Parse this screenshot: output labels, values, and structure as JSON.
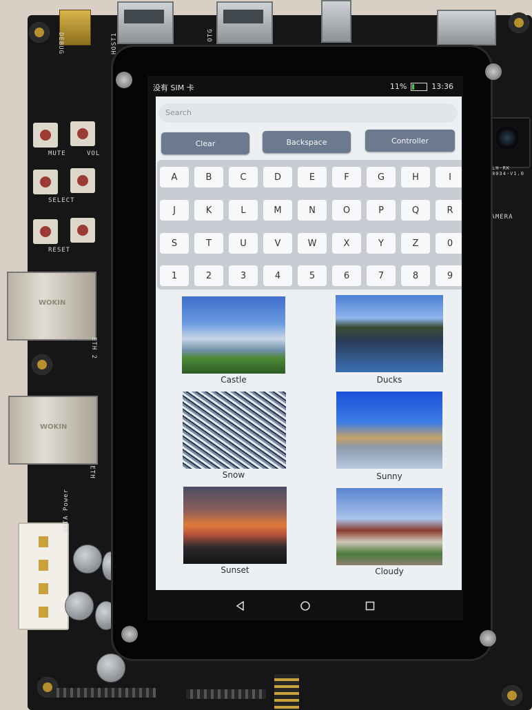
{
  "statusbar": {
    "carrier": "没有 SIM 卡",
    "battery": "11%",
    "time": "13:36"
  },
  "search": {
    "placeholder": "Search"
  },
  "controls": {
    "clear": "Clear",
    "backspace": "Backspace",
    "controller": "Controller"
  },
  "keyboard": {
    "rows": [
      [
        "A",
        "B",
        "C",
        "D",
        "E",
        "F",
        "G",
        "H",
        "I"
      ],
      [
        "J",
        "K",
        "L",
        "M",
        "N",
        "O",
        "P",
        "Q",
        "R"
      ],
      [
        "S",
        "T",
        "U",
        "V",
        "W",
        "X",
        "Y",
        "Z",
        "0"
      ],
      [
        "1",
        "2",
        "3",
        "4",
        "5",
        "6",
        "7",
        "8",
        "9"
      ]
    ]
  },
  "gallery": [
    {
      "label": "Castle"
    },
    {
      "label": "Ducks"
    },
    {
      "label": "Snow"
    },
    {
      "label": "Sunny"
    },
    {
      "label": "Sunset"
    },
    {
      "label": "Cloudy"
    }
  ],
  "board_labels": {
    "debug": "DEBUG",
    "host": "HOST1",
    "otg": "OTG",
    "mute": "MUTE",
    "vol": "VOL",
    "select": "SELECT",
    "reset": "RESET",
    "eth2": "ETH 2",
    "eth": "ETH",
    "sata": "SATA Power",
    "camera": "CAMERA",
    "camera_module": "LH-RK 8034-V1.0"
  }
}
